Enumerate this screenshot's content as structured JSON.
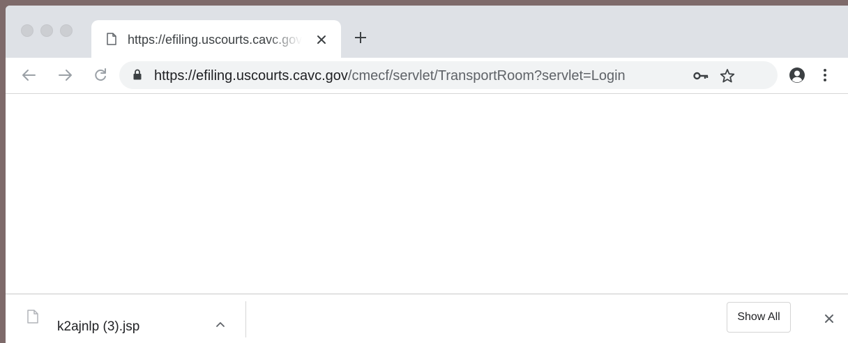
{
  "tab": {
    "title": "https://efiling.uscourts.cavc.gov/cmecf/servlet/TransportRoom?servlet=Login",
    "close_icon": "close-icon",
    "page_icon": "document-icon"
  },
  "new_tab_icon": "plus-icon",
  "toolbar": {
    "back_icon": "arrow-left-icon",
    "forward_icon": "arrow-right-icon",
    "reload_icon": "reload-icon"
  },
  "address_bar": {
    "scheme_host": "https://efiling.uscourts.cavc.gov",
    "path": "/cmecf/servlet/TransportRoom?servlet=Login",
    "lock_icon": "lock-icon",
    "key_icon": "key-icon",
    "star_icon": "star-icon"
  },
  "profile_icon": "account-circle-icon",
  "menu_icon": "kebab-menu-icon",
  "download_shelf": {
    "file_name": "k2ajnlp (3).jsp",
    "file_icon": "file-icon",
    "chevron_icon": "chevron-up-icon",
    "show_all_label": "Show All",
    "close_icon": "close-icon"
  },
  "colors": {
    "tab_strip": "#dee1e6",
    "omnibox": "#f1f3f4",
    "desktop": "#7e6a6a"
  }
}
